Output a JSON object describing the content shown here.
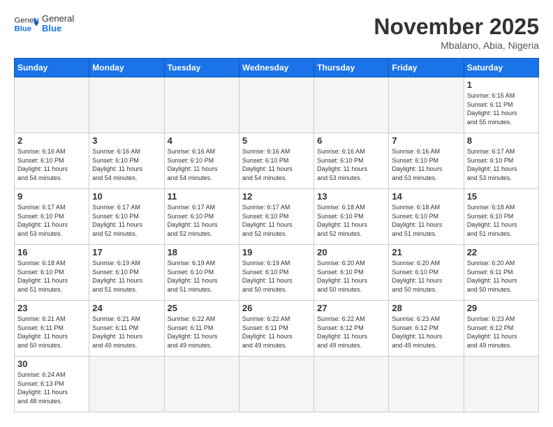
{
  "header": {
    "logo_general": "General",
    "logo_blue": "Blue",
    "month_title": "November 2025",
    "location": "Mbalano, Abia, Nigeria"
  },
  "weekdays": [
    "Sunday",
    "Monday",
    "Tuesday",
    "Wednesday",
    "Thursday",
    "Friday",
    "Saturday"
  ],
  "weeks": [
    [
      {
        "day": "",
        "info": ""
      },
      {
        "day": "",
        "info": ""
      },
      {
        "day": "",
        "info": ""
      },
      {
        "day": "",
        "info": ""
      },
      {
        "day": "",
        "info": ""
      },
      {
        "day": "",
        "info": ""
      },
      {
        "day": "1",
        "info": "Sunrise: 6:15 AM\nSunset: 6:11 PM\nDaylight: 11 hours\nand 55 minutes."
      }
    ],
    [
      {
        "day": "2",
        "info": "Sunrise: 6:16 AM\nSunset: 6:10 PM\nDaylight: 11 hours\nand 54 minutes."
      },
      {
        "day": "3",
        "info": "Sunrise: 6:16 AM\nSunset: 6:10 PM\nDaylight: 11 hours\nand 54 minutes."
      },
      {
        "day": "4",
        "info": "Sunrise: 6:16 AM\nSunset: 6:10 PM\nDaylight: 11 hours\nand 54 minutes."
      },
      {
        "day": "5",
        "info": "Sunrise: 6:16 AM\nSunset: 6:10 PM\nDaylight: 11 hours\nand 54 minutes."
      },
      {
        "day": "6",
        "info": "Sunrise: 6:16 AM\nSunset: 6:10 PM\nDaylight: 11 hours\nand 53 minutes."
      },
      {
        "day": "7",
        "info": "Sunrise: 6:16 AM\nSunset: 6:10 PM\nDaylight: 11 hours\nand 53 minutes."
      },
      {
        "day": "8",
        "info": "Sunrise: 6:17 AM\nSunset: 6:10 PM\nDaylight: 11 hours\nand 53 minutes."
      }
    ],
    [
      {
        "day": "9",
        "info": "Sunrise: 6:17 AM\nSunset: 6:10 PM\nDaylight: 11 hours\nand 53 minutes."
      },
      {
        "day": "10",
        "info": "Sunrise: 6:17 AM\nSunset: 6:10 PM\nDaylight: 11 hours\nand 52 minutes."
      },
      {
        "day": "11",
        "info": "Sunrise: 6:17 AM\nSunset: 6:10 PM\nDaylight: 11 hours\nand 52 minutes."
      },
      {
        "day": "12",
        "info": "Sunrise: 6:17 AM\nSunset: 6:10 PM\nDaylight: 11 hours\nand 52 minutes."
      },
      {
        "day": "13",
        "info": "Sunrise: 6:18 AM\nSunset: 6:10 PM\nDaylight: 11 hours\nand 52 minutes."
      },
      {
        "day": "14",
        "info": "Sunrise: 6:18 AM\nSunset: 6:10 PM\nDaylight: 11 hours\nand 51 minutes."
      },
      {
        "day": "15",
        "info": "Sunrise: 6:18 AM\nSunset: 6:10 PM\nDaylight: 11 hours\nand 51 minutes."
      }
    ],
    [
      {
        "day": "16",
        "info": "Sunrise: 6:18 AM\nSunset: 6:10 PM\nDaylight: 11 hours\nand 51 minutes."
      },
      {
        "day": "17",
        "info": "Sunrise: 6:19 AM\nSunset: 6:10 PM\nDaylight: 11 hours\nand 51 minutes."
      },
      {
        "day": "18",
        "info": "Sunrise: 6:19 AM\nSunset: 6:10 PM\nDaylight: 11 hours\nand 51 minutes."
      },
      {
        "day": "19",
        "info": "Sunrise: 6:19 AM\nSunset: 6:10 PM\nDaylight: 11 hours\nand 50 minutes."
      },
      {
        "day": "20",
        "info": "Sunrise: 6:20 AM\nSunset: 6:10 PM\nDaylight: 11 hours\nand 50 minutes."
      },
      {
        "day": "21",
        "info": "Sunrise: 6:20 AM\nSunset: 6:10 PM\nDaylight: 11 hours\nand 50 minutes."
      },
      {
        "day": "22",
        "info": "Sunrise: 6:20 AM\nSunset: 6:11 PM\nDaylight: 11 hours\nand 50 minutes."
      }
    ],
    [
      {
        "day": "23",
        "info": "Sunrise: 6:21 AM\nSunset: 6:11 PM\nDaylight: 11 hours\nand 50 minutes."
      },
      {
        "day": "24",
        "info": "Sunrise: 6:21 AM\nSunset: 6:11 PM\nDaylight: 11 hours\nand 49 minutes."
      },
      {
        "day": "25",
        "info": "Sunrise: 6:22 AM\nSunset: 6:11 PM\nDaylight: 11 hours\nand 49 minutes."
      },
      {
        "day": "26",
        "info": "Sunrise: 6:22 AM\nSunset: 6:11 PM\nDaylight: 11 hours\nand 49 minutes."
      },
      {
        "day": "27",
        "info": "Sunrise: 6:22 AM\nSunset: 6:12 PM\nDaylight: 11 hours\nand 49 minutes."
      },
      {
        "day": "28",
        "info": "Sunrise: 6:23 AM\nSunset: 6:12 PM\nDaylight: 11 hours\nand 49 minutes."
      },
      {
        "day": "29",
        "info": "Sunrise: 6:23 AM\nSunset: 6:12 PM\nDaylight: 11 hours\nand 49 minutes."
      }
    ],
    [
      {
        "day": "30",
        "info": "Sunrise: 6:24 AM\nSunset: 6:13 PM\nDaylight: 11 hours\nand 48 minutes."
      },
      {
        "day": "",
        "info": ""
      },
      {
        "day": "",
        "info": ""
      },
      {
        "day": "",
        "info": ""
      },
      {
        "day": "",
        "info": ""
      },
      {
        "day": "",
        "info": ""
      },
      {
        "day": "",
        "info": ""
      }
    ]
  ]
}
